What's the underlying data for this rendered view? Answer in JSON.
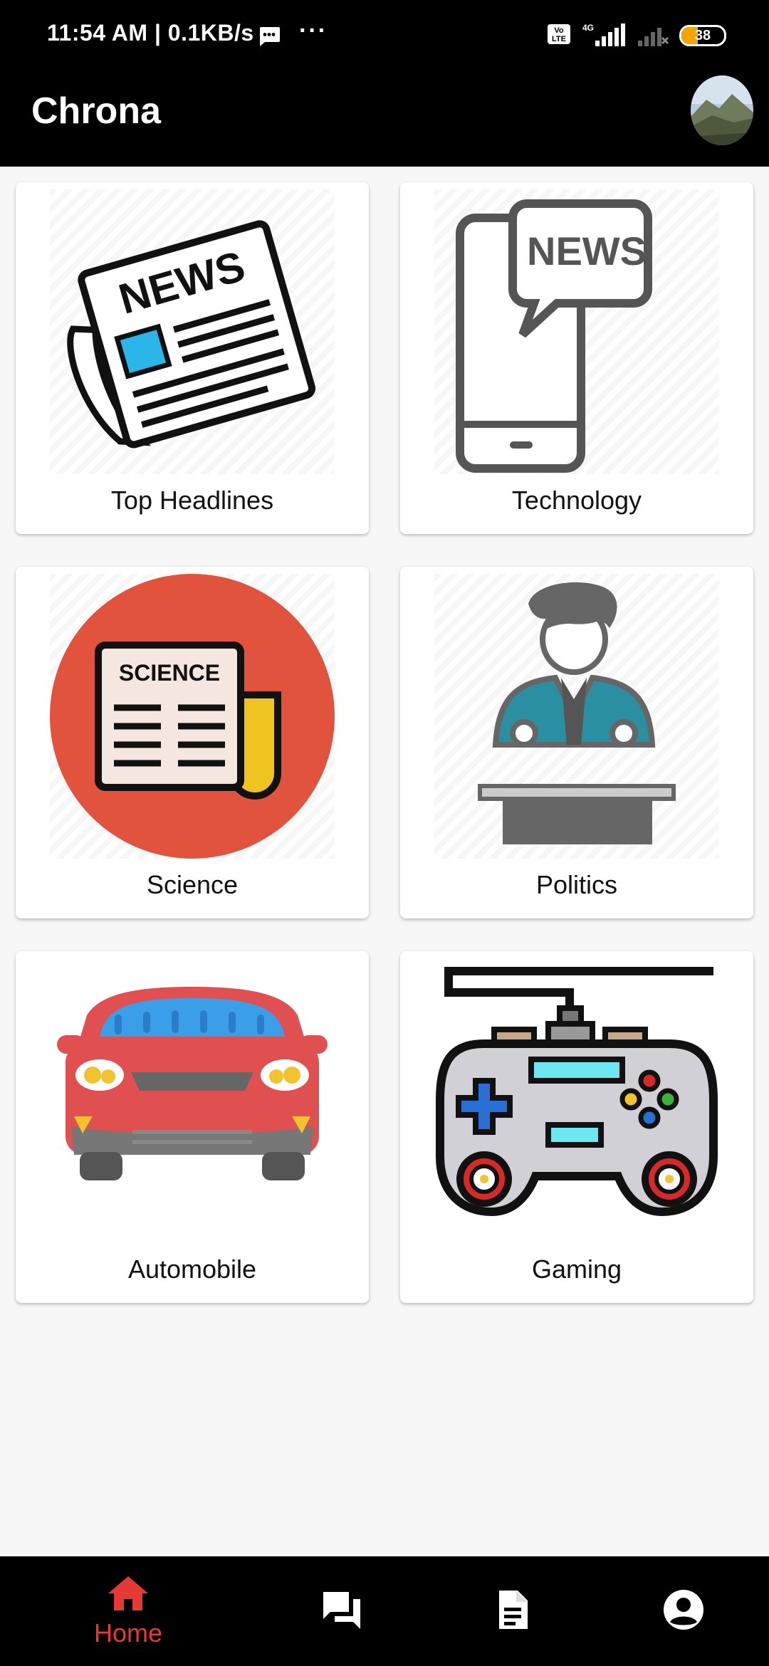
{
  "status_bar": {
    "time_speed": "11:54 AM | 0.1KB/s",
    "more": "···",
    "network_label": "4G",
    "volte_label": "Vo LTE",
    "battery_level": "38",
    "battery_fraction": 0.38,
    "battery_color": "#f2a400"
  },
  "app_bar": {
    "title": "Chrona",
    "avatar_icon": "profile-photo-mountain"
  },
  "categories": [
    {
      "label": "Top Headlines",
      "icon": "newspaper-icon",
      "art_text": "NEWS"
    },
    {
      "label": "Technology",
      "icon": "phone-news-icon",
      "art_text": "NEWS"
    },
    {
      "label": "Science",
      "icon": "science-newspaper-icon",
      "art_text": "SCIENCE"
    },
    {
      "label": "Politics",
      "icon": "politician-podium-icon"
    },
    {
      "label": "Automobile",
      "icon": "car-icon"
    },
    {
      "label": "Gaming",
      "icon": "gamepad-icon"
    }
  ],
  "bottom_nav": {
    "active_color": "#e53935",
    "items": [
      {
        "label": "Home",
        "icon": "home-icon",
        "active": true
      },
      {
        "label": "",
        "icon": "forum-icon",
        "active": false
      },
      {
        "label": "",
        "icon": "document-icon",
        "active": false
      },
      {
        "label": "",
        "icon": "account-circle-icon",
        "active": false
      }
    ]
  }
}
